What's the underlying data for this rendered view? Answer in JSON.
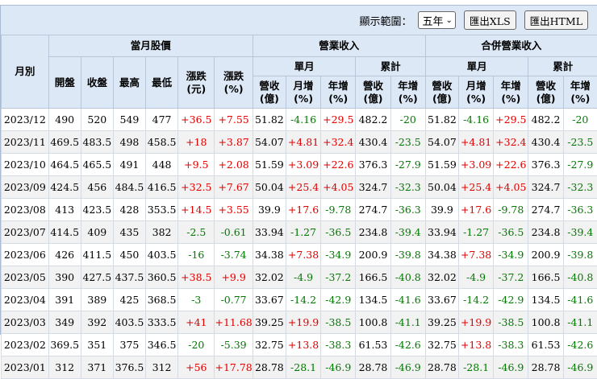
{
  "toolbar": {
    "range_label": "顯示範圍：",
    "range_value": "五年",
    "export_xls": "匯出XLS",
    "export_html": "匯出HTML"
  },
  "headers": {
    "month": "月別",
    "stock_group": "當月股價",
    "revenue_group": "營業收入",
    "consolidated_group": "合併營業收入",
    "monthly": "單月",
    "cumulative": "累計",
    "open": "開盤",
    "close": "收盤",
    "high": "最高",
    "low": "最低",
    "change_amt": "漲跌(元)",
    "change_pct": "漲跌(%)",
    "rev": "營收(億)",
    "mom": "月增(%)",
    "yoy": "年增(%)"
  },
  "rows": [
    [
      "2023/12",
      "490",
      "520",
      "549",
      "477",
      "+36.5",
      "+7.55",
      "51.82",
      "-4.16",
      "+29.5",
      "482.2",
      "-20",
      "51.82",
      "-4.16",
      "+29.5",
      "482.2",
      "-20"
    ],
    [
      "2023/11",
      "469.5",
      "483.5",
      "498",
      "458.5",
      "+18",
      "+3.87",
      "54.07",
      "+4.81",
      "+32.4",
      "430.4",
      "-23.5",
      "54.07",
      "+4.81",
      "+32.4",
      "430.4",
      "-23.5"
    ],
    [
      "2023/10",
      "464.5",
      "465.5",
      "491",
      "448",
      "+9.5",
      "+2.08",
      "51.59",
      "+3.09",
      "+22.6",
      "376.3",
      "-27.9",
      "51.59",
      "+3.09",
      "+22.6",
      "376.3",
      "-27.9"
    ],
    [
      "2023/09",
      "424.5",
      "456",
      "484.5",
      "416.5",
      "+32.5",
      "+7.67",
      "50.04",
      "+25.4",
      "+4.05",
      "324.7",
      "-32.3",
      "50.04",
      "+25.4",
      "+4.05",
      "324.7",
      "-32.3"
    ],
    [
      "2023/08",
      "413",
      "423.5",
      "428",
      "353.5",
      "+14.5",
      "+3.55",
      "39.9",
      "+17.6",
      "-9.78",
      "274.7",
      "-36.3",
      "39.9",
      "+17.6",
      "-9.78",
      "274.7",
      "-36.3"
    ],
    [
      "2023/07",
      "414.5",
      "409",
      "435",
      "382",
      "-2.5",
      "-0.61",
      "33.94",
      "-1.27",
      "-36.5",
      "234.8",
      "-39.4",
      "33.94",
      "-1.27",
      "-36.5",
      "234.8",
      "-39.4"
    ],
    [
      "2023/06",
      "426",
      "411.5",
      "450",
      "403.5",
      "-16",
      "-3.74",
      "34.38",
      "+7.38",
      "-34.9",
      "200.9",
      "-39.8",
      "34.38",
      "+7.38",
      "-34.9",
      "200.9",
      "-39.8"
    ],
    [
      "2023/05",
      "390",
      "427.5",
      "437.5",
      "360.5",
      "+38.5",
      "+9.9",
      "32.02",
      "-4.9",
      "-37.2",
      "166.5",
      "-40.8",
      "32.02",
      "-4.9",
      "-37.2",
      "166.5",
      "-40.8"
    ],
    [
      "2023/04",
      "391",
      "389",
      "425",
      "368.5",
      "-3",
      "-0.77",
      "33.67",
      "-14.2",
      "-42.9",
      "134.5",
      "-41.6",
      "33.67",
      "-14.2",
      "-42.9",
      "134.5",
      "-41.6"
    ],
    [
      "2023/03",
      "349",
      "392",
      "403.5",
      "333.5",
      "+41",
      "+11.68",
      "39.25",
      "+19.9",
      "-38.5",
      "100.8",
      "-41.1",
      "39.25",
      "+19.9",
      "-38.5",
      "100.8",
      "-41.1"
    ],
    [
      "2023/02",
      "369.5",
      "351",
      "375",
      "346.5",
      "-20",
      "-5.39",
      "32.75",
      "+13.8",
      "-38.3",
      "61.53",
      "-42.6",
      "32.75",
      "+13.8",
      "-38.3",
      "61.53",
      "-42.6"
    ],
    [
      "2023/01",
      "312",
      "371",
      "376.5",
      "312",
      "+56",
      "+17.78",
      "28.78",
      "-28.1",
      "-46.9",
      "28.78",
      "-46.9",
      "28.78",
      "-28.1",
      "-46.9",
      "28.78",
      "-46.9"
    ]
  ],
  "colors": {
    "header_bg": "#dce8f5",
    "positive": "#e00000",
    "negative": "#007a00",
    "alt_row": "#f2f2f2"
  }
}
